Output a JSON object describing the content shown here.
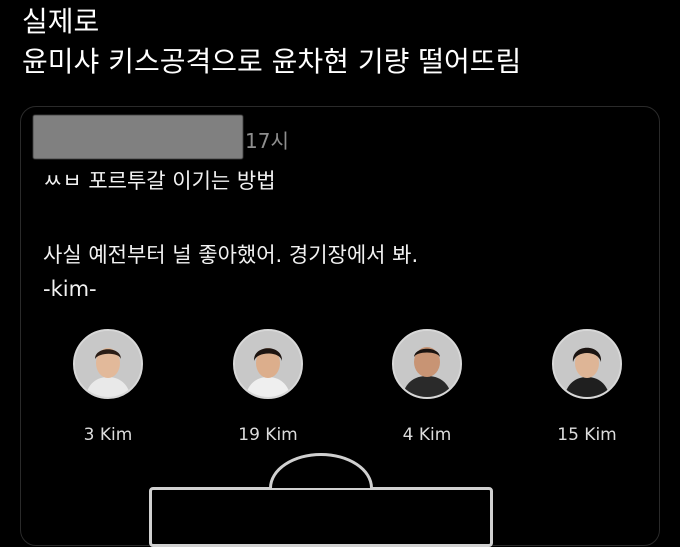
{
  "headline": {
    "line1": "실제로",
    "line2": "윤미샤 키스공격으로 윤차현 기량 떨어뜨림"
  },
  "post": {
    "timestamp": "17시",
    "title_line": "ㅆㅂ 포르투갈 이기는 방법",
    "body_line": "사실 예전부터 널 좋아했어. 경기장에서 봐.",
    "signature": "-kim-"
  },
  "players": [
    {
      "label": "3 Kim"
    },
    {
      "label": "19 Kim"
    },
    {
      "label": "4 Kim"
    },
    {
      "label": "15 Kim"
    }
  ],
  "colors": {
    "background": "#000000",
    "text": "#ffffff",
    "muted": "#8e8e8e",
    "redaction": "#808080"
  }
}
